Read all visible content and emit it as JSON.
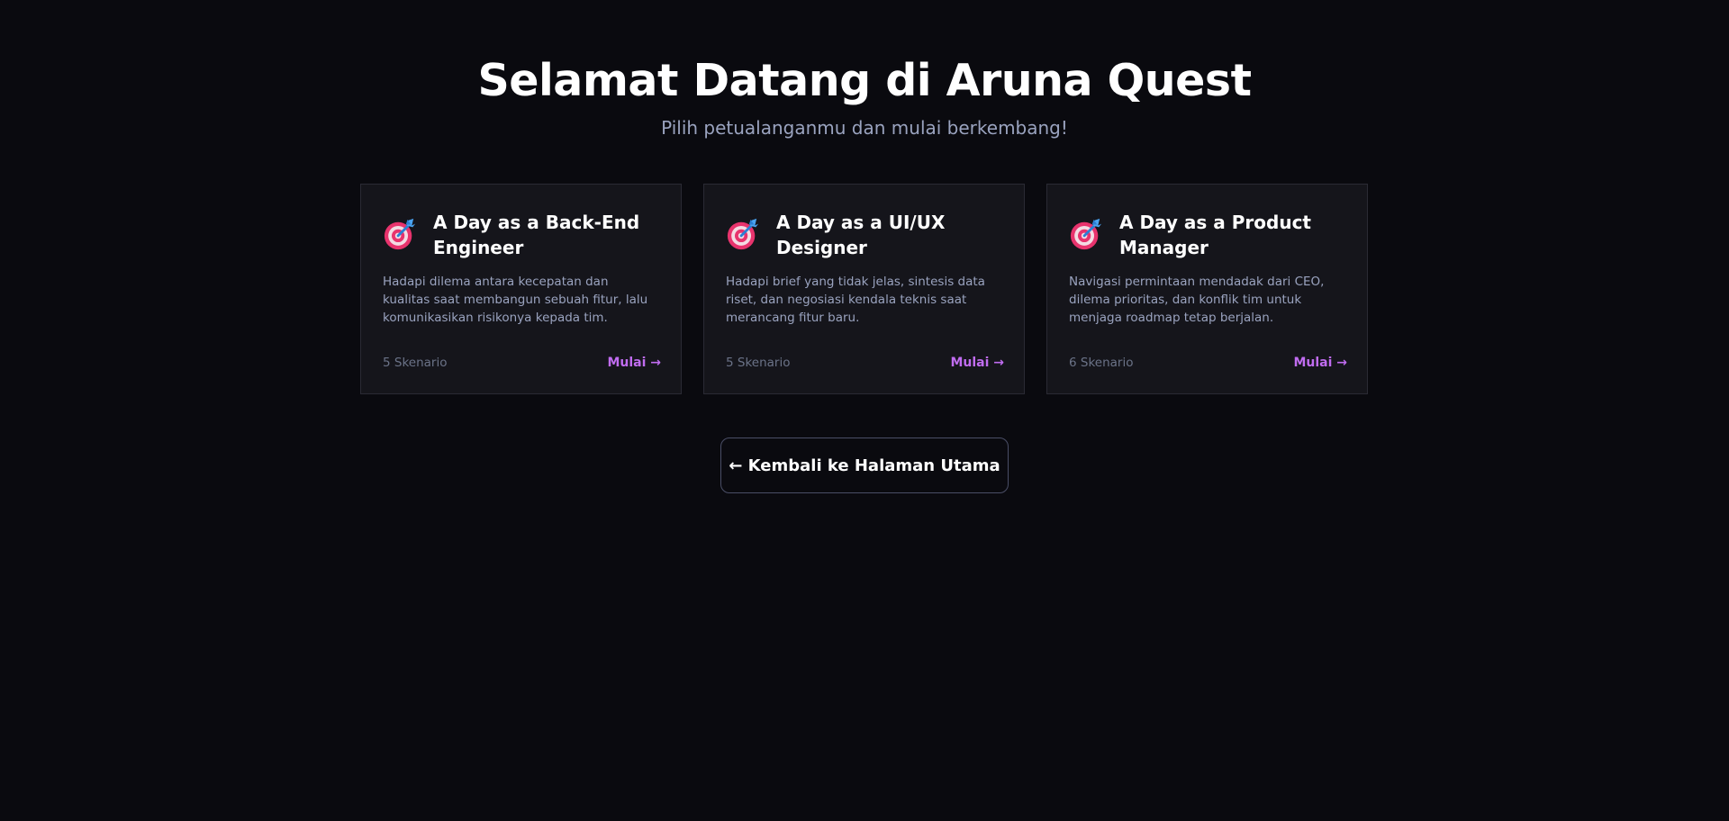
{
  "hero": {
    "title": "Selamat Datang di Aruna Quest",
    "subtitle": "Pilih petualanganmu dan mulai berkembang!"
  },
  "colors": {
    "background": "#0a0a0f",
    "card_background": "#15151b",
    "accent": "#c06cf0",
    "muted_text": "#9aa3bf"
  },
  "cards": [
    {
      "icon": "target-icon",
      "title": "A Day as a Back-End Engineer",
      "description": "Hadapi dilema antara kecepatan dan kualitas saat membangun sebuah fitur, lalu komunikasikan risikonya kepada tim.",
      "count": "5 Skenario",
      "action": "Mulai →"
    },
    {
      "icon": "target-icon",
      "title": "A Day as a UI/UX Designer",
      "description": "Hadapi brief yang tidak jelas, sintesis data riset, dan negosiasi kendala teknis saat merancang fitur baru.",
      "count": "5 Skenario",
      "action": "Mulai →"
    },
    {
      "icon": "target-icon",
      "title": "A Day as a Product Manager",
      "description": "Navigasi permintaan mendadak dari CEO, dilema prioritas, dan konflik tim untuk menjaga roadmap tetap berjalan.",
      "count": "6 Skenario",
      "action": "Mulai →"
    }
  ],
  "back_button": {
    "label": "← Kembali ke Halaman Utama"
  }
}
